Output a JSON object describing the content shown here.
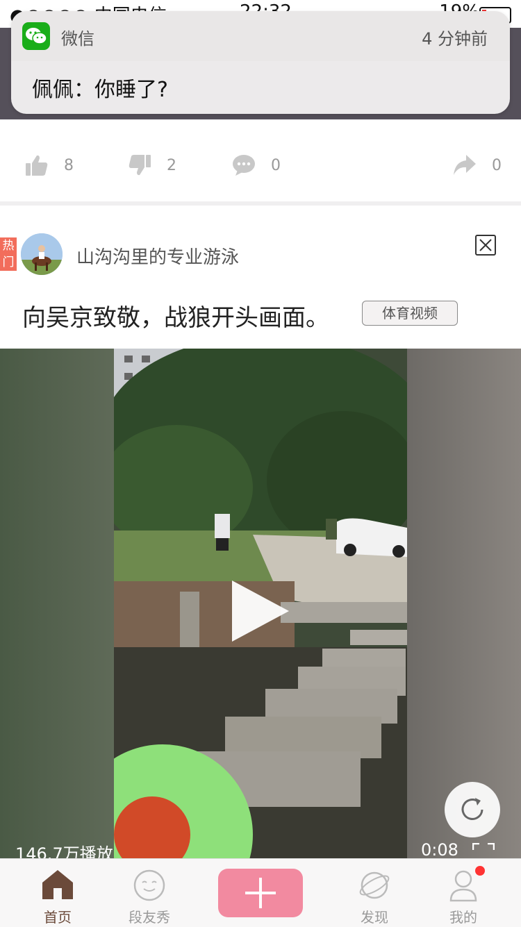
{
  "status_bar": {
    "carrier": "●○○○○ 中国电信 ",
    "time": "22:32",
    "battery": "19%"
  },
  "notification": {
    "app_name": "微信",
    "time_ago": "4 分钟前",
    "message": "佩佩：你睡了?"
  },
  "actions": {
    "likes": "8",
    "dislikes": "2",
    "comments": "0",
    "shares": "0"
  },
  "post": {
    "hot_badge": "热门",
    "username": "山沟沟里的专业游泳",
    "title": "向吴京致敬，战狼开头画面。",
    "tag": "体育视频"
  },
  "video": {
    "play_count": "146.7万播放",
    "duration": "0:08"
  },
  "tabbar": {
    "home": "首页",
    "friends": "段友秀",
    "discover": "发现",
    "mine": "我的"
  },
  "colors": {
    "accent_pink": "#f28aa0",
    "hot_badge": "#f26d5b",
    "home_active": "#6b4a3a",
    "wechat_green": "#1aad19"
  }
}
